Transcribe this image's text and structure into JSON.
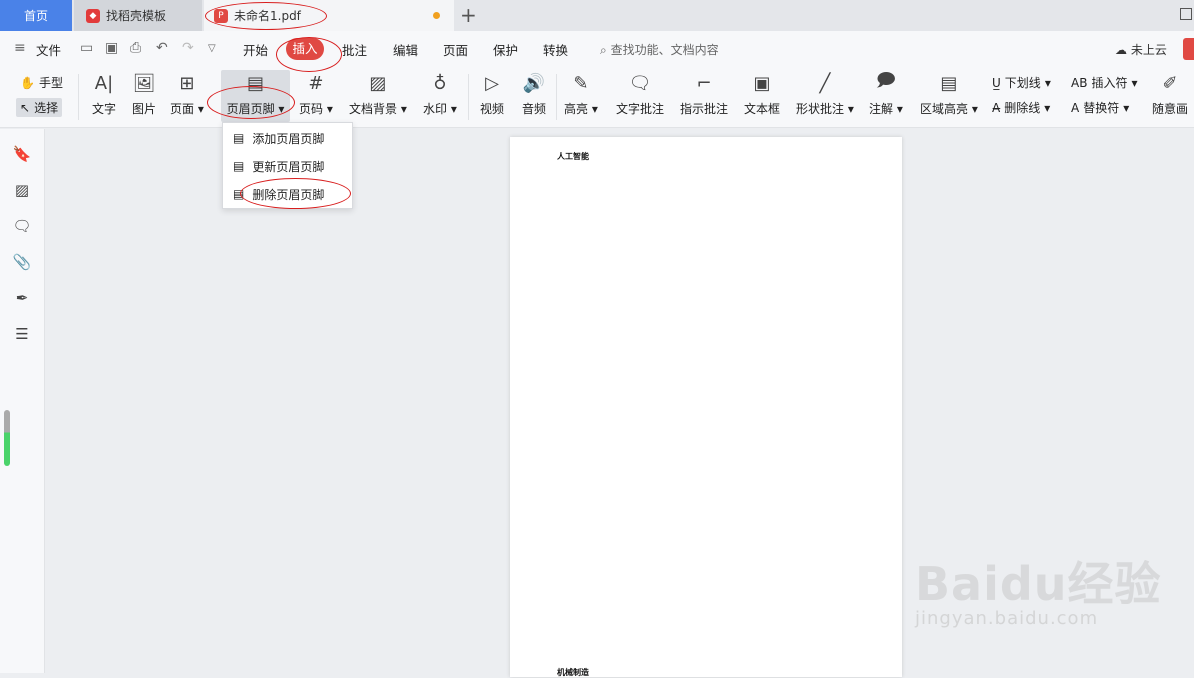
{
  "tabs": {
    "home": "首页",
    "template": "找稻壳模板",
    "document": "未命名1.pdf"
  },
  "menu": {
    "file": "文件",
    "start": "开始",
    "insert": "插入",
    "annotate": "批注",
    "edit": "编辑",
    "page": "页面",
    "protect": "保护",
    "convert": "转换",
    "search_placeholder": "查找功能、文档内容",
    "cloud": "未上云"
  },
  "ribbon": {
    "hand": "手型",
    "select": "选择",
    "text": "文字",
    "image": "图片",
    "page": "页面",
    "header_footer": "页眉页脚",
    "page_number": "页码",
    "doc_background": "文档背景",
    "watermark": "水印",
    "video": "视频",
    "audio": "音频",
    "highlight": "高亮",
    "text_annotation": "文字批注",
    "pointer_annotation": "指示批注",
    "textbox": "文本框",
    "shape_annotation": "形状批注",
    "note": "注解",
    "area_highlight": "区域高亮",
    "underline": "下划线",
    "strikethrough": "删除线",
    "insert_char": "插入符",
    "replace_char": "替换符",
    "freehand": "随意画"
  },
  "dropdown": {
    "add": "添加页眉页脚",
    "update": "更新页眉页脚",
    "delete": "删除页眉页脚"
  },
  "document_page": {
    "header_text": "人工智能",
    "footer_text": "机械制造"
  },
  "watermark": {
    "brand": "Baidu经验",
    "url": "jingyan.baidu.com"
  },
  "colors": {
    "accent_red": "#e04943",
    "home_tab_blue": "#4a82e8",
    "annotation_red": "#d81e1e",
    "unsaved_dot": "#f0a020"
  }
}
